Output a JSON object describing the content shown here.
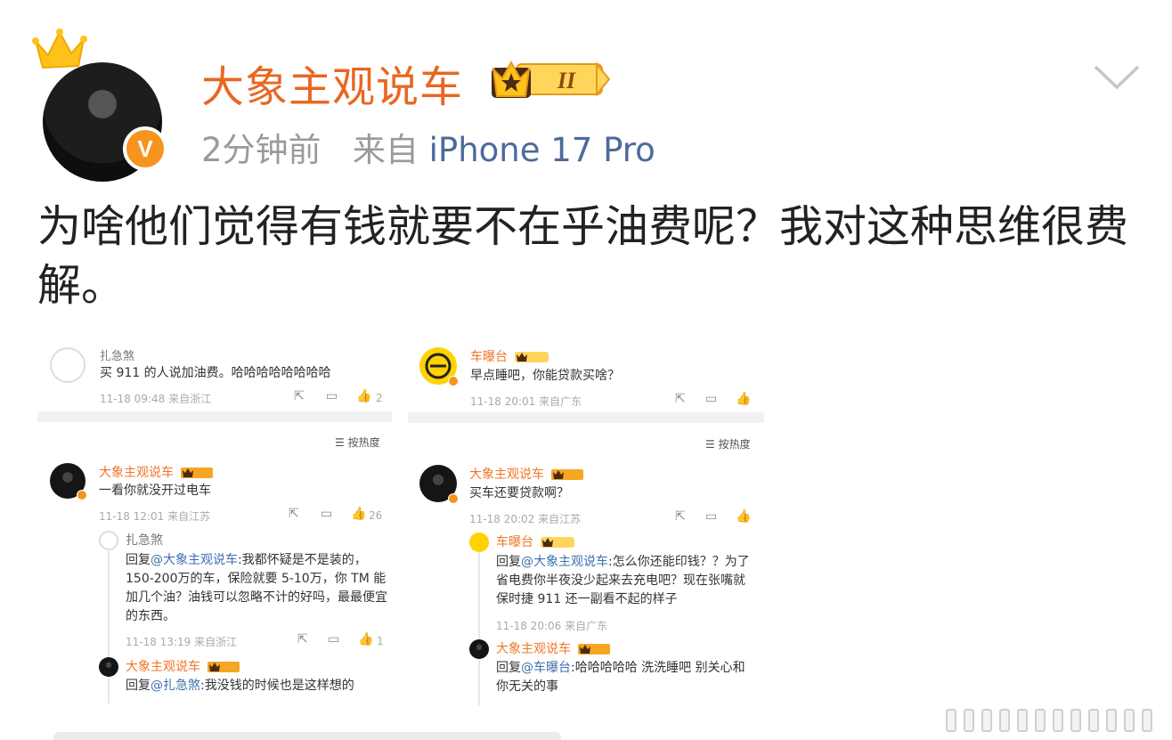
{
  "post": {
    "username": "大象主观说车",
    "verified_badge": "V",
    "time": "2分钟前",
    "source_prefix": "来自",
    "source": "iPhone 17 Pro",
    "text": "为啥他们觉得有钱就要不在乎油费呢？我对这种思维很费解。"
  },
  "left_shot": {
    "top_comment": {
      "name": "扎急煞",
      "text": "买 911 的人说加油费。哈哈哈哈哈哈哈哈",
      "meta": "11-18 09:48 来自浙江",
      "likes": "2"
    },
    "sort_label": "按热度",
    "comment": {
      "name": "大象主观说车",
      "text": "一看你就没开过电车",
      "meta": "11-18 12:01 来自江苏",
      "likes": "26"
    },
    "reply1": {
      "name": "扎急煞",
      "prefix": "回复",
      "at": "@大象主观说车",
      "text": ":我都怀疑是不是装的，150-200万的车，保险就要 5-10万，你 TM 能加几个油？油钱可以忽略不计的好吗，最最便宜的东西。",
      "meta": "11-18 13:19 来自浙江",
      "likes": "1"
    },
    "reply2": {
      "name": "大象主观说车",
      "prefix": "回复",
      "at": "@扎急煞",
      "text": ":我没钱的时候也是这样想的"
    }
  },
  "right_shot": {
    "top_comment": {
      "name": "车曝台",
      "text": "早点睡吧，你能贷款买啥？",
      "meta": "11-18 20:01 来自广东"
    },
    "sort_label": "按热度",
    "comment": {
      "name": "大象主观说车",
      "text": "买车还要贷款啊？",
      "meta": "11-18 20:02 来自江苏"
    },
    "reply1": {
      "name": "车曝台",
      "prefix": "回复",
      "at": "@大象主观说车",
      "text": ":怎么你还能印钱？？为了省电费你半夜没少起来去充电吧？现在张嘴就保时捷 911 还一副看不起的样子",
      "meta": "11-18 20:06 来自广东"
    },
    "reply2": {
      "name": "大象主观说车",
      "prefix": "回复",
      "at": "@车曝台",
      "text": ":哈哈哈哈哈 洗洗睡吧 别关心和你无关的事"
    }
  },
  "colors": {
    "username": "#e86722",
    "source_link": "#4b6b9a",
    "at_link": "#3d6fae",
    "verified": "#f7941d"
  },
  "icons": [
    "crown-icon",
    "verified-v-icon",
    "level-2-badge-icon",
    "chevron-down-icon",
    "share-icon",
    "comment-icon",
    "like-icon",
    "sort-icon"
  ]
}
